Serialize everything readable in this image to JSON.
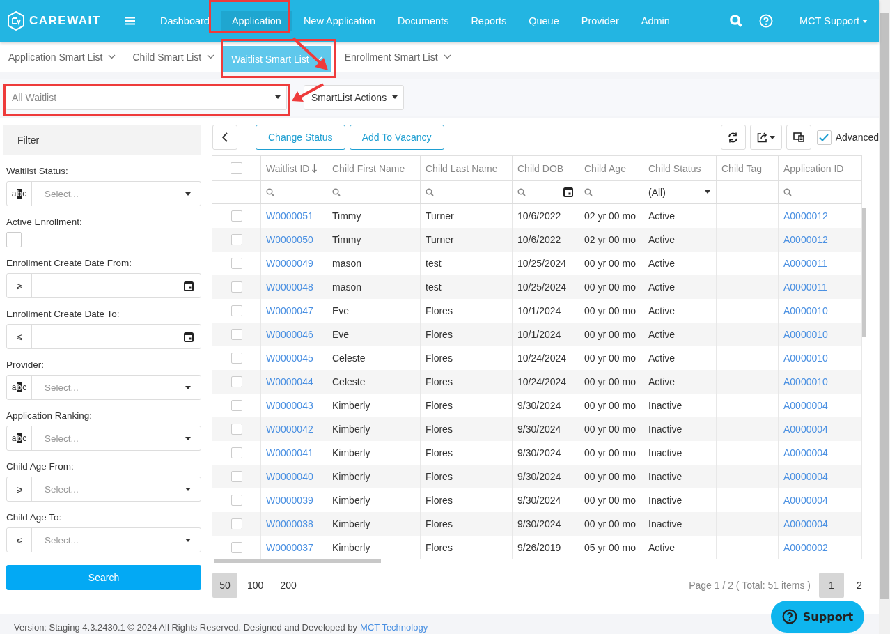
{
  "nav": {
    "logo": "CAREWAIT",
    "items": [
      {
        "label": "Dashboard",
        "selected": false
      },
      {
        "label": "Application",
        "selected": true
      },
      {
        "label": "New Application",
        "selected": false
      },
      {
        "label": "Documents",
        "selected": false
      },
      {
        "label": "Reports",
        "selected": false
      },
      {
        "label": "Queue",
        "selected": false
      },
      {
        "label": "Provider",
        "selected": false
      },
      {
        "label": "Admin",
        "selected": false
      }
    ],
    "user": "MCT Support"
  },
  "subnav": [
    {
      "label": "Application Smart List",
      "selected": false
    },
    {
      "label": "Child Smart List",
      "selected": false
    },
    {
      "label": "Waitlist Smart List",
      "selected": true
    },
    {
      "label": "Enrollment Smart List",
      "selected": false
    }
  ],
  "toolbar": {
    "list_select": "All Waitlist",
    "actions": "SmartList Actions"
  },
  "filter": {
    "title": "Filter",
    "fields": [
      {
        "label": "Waitlist Status:",
        "kind": "select",
        "operator": "abc",
        "placeholder": "Select..."
      },
      {
        "label": "Active Enrollment:",
        "kind": "checkbox",
        "checked": false
      },
      {
        "label": "Enrollment Create Date From:",
        "kind": "date",
        "operator": "⩾"
      },
      {
        "label": "Enrollment Create Date To:",
        "kind": "date",
        "operator": "⩽"
      },
      {
        "label": "Provider:",
        "kind": "select",
        "operator": "abc",
        "placeholder": "Select..."
      },
      {
        "label": "Application Ranking:",
        "kind": "select",
        "operator": "abc",
        "placeholder": "Select..."
      },
      {
        "label": "Child Age From:",
        "kind": "select",
        "operator": "⩾",
        "placeholder": "Select..."
      },
      {
        "label": "Child Age To:",
        "kind": "select",
        "operator": "⩽",
        "placeholder": "Select..."
      }
    ],
    "search_button": "Search"
  },
  "table": {
    "buttons": [
      "Change Status",
      "Add To Vacancy"
    ],
    "advanced": {
      "label": "Advanced",
      "checked": true
    },
    "header_checked": false,
    "columns": [
      {
        "label": "Waitlist ID",
        "sorted": true,
        "filter": {
          "kind": "search"
        }
      },
      {
        "label": "Child First Name",
        "sorted": false,
        "filter": {
          "kind": "search"
        }
      },
      {
        "label": "Child Last Name",
        "sorted": false,
        "filter": {
          "kind": "search"
        }
      },
      {
        "label": "Child DOB",
        "sorted": false,
        "filter": {
          "kind": "date"
        }
      },
      {
        "label": "Child Age",
        "sorted": false,
        "filter": {
          "kind": "search"
        }
      },
      {
        "label": "Child Status",
        "sorted": false,
        "filter": {
          "kind": "select",
          "value": "(All)"
        }
      },
      {
        "label": "Child Tag",
        "sorted": false,
        "filter": {
          "kind": "none"
        }
      },
      {
        "label": "Application ID",
        "sorted": false,
        "filter": {
          "kind": "search"
        }
      }
    ],
    "rows": [
      {
        "checked": false,
        "cells": [
          "W0000051",
          "Timmy",
          "Turner",
          "10/6/2022",
          "02 yr 00 mo",
          "Active",
          "",
          "A0000012"
        ]
      },
      {
        "checked": false,
        "cells": [
          "W0000050",
          "Timmy",
          "Turner",
          "10/6/2022",
          "02 yr 00 mo",
          "Active",
          "",
          "A0000012"
        ]
      },
      {
        "checked": false,
        "cells": [
          "W0000049",
          "mason",
          "test",
          "10/25/2024",
          "00 yr 00 mo",
          "Active",
          "",
          "A0000011"
        ]
      },
      {
        "checked": false,
        "cells": [
          "W0000048",
          "mason",
          "test",
          "10/25/2024",
          "00 yr 00 mo",
          "Active",
          "",
          "A0000011"
        ]
      },
      {
        "checked": false,
        "cells": [
          "W0000047",
          "Eve",
          "Flores",
          "10/1/2024",
          "00 yr 00 mo",
          "Active",
          "",
          "A0000010"
        ]
      },
      {
        "checked": false,
        "cells": [
          "W0000046",
          "Eve",
          "Flores",
          "10/1/2024",
          "00 yr 00 mo",
          "Active",
          "",
          "A0000010"
        ]
      },
      {
        "checked": false,
        "cells": [
          "W0000045",
          "Celeste",
          "Flores",
          "10/24/2024",
          "00 yr 00 mo",
          "Active",
          "",
          "A0000010"
        ]
      },
      {
        "checked": false,
        "cells": [
          "W0000044",
          "Celeste",
          "Flores",
          "10/24/2024",
          "00 yr 00 mo",
          "Active",
          "",
          "A0000010"
        ]
      },
      {
        "checked": false,
        "cells": [
          "W0000043",
          "Kimberly",
          "Flores",
          "9/30/2024",
          "00 yr 00 mo",
          "Inactive",
          "",
          "A0000004"
        ]
      },
      {
        "checked": false,
        "cells": [
          "W0000042",
          "Kimberly",
          "Flores",
          "9/30/2024",
          "00 yr 00 mo",
          "Inactive",
          "",
          "A0000004"
        ]
      },
      {
        "checked": false,
        "cells": [
          "W0000041",
          "Kimberly",
          "Flores",
          "9/30/2024",
          "00 yr 00 mo",
          "Inactive",
          "",
          "A0000004"
        ]
      },
      {
        "checked": false,
        "cells": [
          "W0000040",
          "Kimberly",
          "Flores",
          "9/30/2024",
          "00 yr 00 mo",
          "Inactive",
          "",
          "A0000004"
        ]
      },
      {
        "checked": false,
        "cells": [
          "W0000039",
          "Kimberly",
          "Flores",
          "9/30/2024",
          "00 yr 00 mo",
          "Inactive",
          "",
          "A0000004"
        ]
      },
      {
        "checked": false,
        "cells": [
          "W0000038",
          "Kimberly",
          "Flores",
          "9/30/2024",
          "00 yr 00 mo",
          "Inactive",
          "",
          "A0000004"
        ]
      },
      {
        "checked": false,
        "cells": [
          "W0000037",
          "Kimberly",
          "Flores",
          "9/26/2019",
          "05 yr 00 mo",
          "Active",
          "",
          "A0000002"
        ]
      }
    ],
    "page_sizes": [
      {
        "label": "50",
        "selected": true
      },
      {
        "label": "100",
        "selected": false
      },
      {
        "label": "200",
        "selected": false
      }
    ],
    "page_info": "Page 1 / 2 ( Total: 51 items )",
    "pages": [
      {
        "label": "1",
        "selected": true
      },
      {
        "label": "2",
        "selected": false
      }
    ]
  },
  "support_button": "Support",
  "footer": {
    "text": "Version: Staging 4.3.2430.1 © 2024 All Rights Reserved. Designed and Developed by",
    "link": "MCT Technology"
  }
}
